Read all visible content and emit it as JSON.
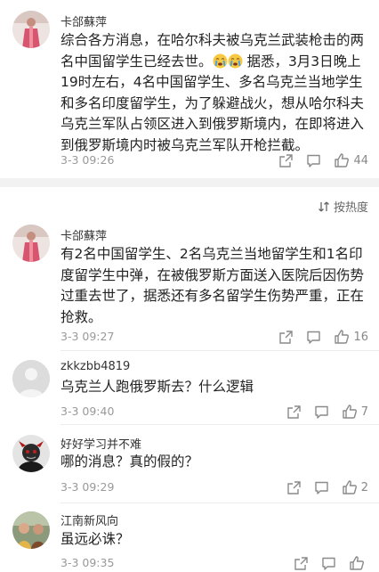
{
  "sort": {
    "label": "按热度"
  },
  "comments": [
    {
      "user": "卡郃蘇萍",
      "text_a": "综合各方消息，在哈尔科夫被乌克兰武装枪击的两名中国留学生已经去世。",
      "text_b": " 据悉，3月3日晚上19时左右，4名中国留学生、多名乌克兰当地学生和多名印度留学生，为了躲避战火，想从哈尔科夫乌克兰军队占领区进入到俄罗斯境内，在即将进入到俄罗斯境内时被乌克兰军队开枪拦截。",
      "emoji_icon": "crying-face-emoji",
      "time": "3-3 09:26",
      "likes": "44"
    },
    {
      "user": "卡郃蘇萍",
      "text": "有2名中国留学生、2名乌克兰当地留学生和1名印度留学生中弹，在被俄罗斯方面送入医院后因伤势过重去世了，据悉还有多名留学生伤势严重，正在抢救。",
      "time": "3-3 09:27",
      "likes": "16"
    },
    {
      "user": "zkkzbb4819",
      "text": "乌克兰人跑俄罗斯去？什么逻辑",
      "time": "3-3 09:40",
      "likes": "7"
    },
    {
      "user": "好好学习并不难",
      "text": "哪的消息？真的假的？",
      "time": "3-3 09:29",
      "likes": "2"
    },
    {
      "user": "江南新风向",
      "text": "虽远必诛？",
      "time": "3-3 09:35",
      "likes": ""
    }
  ],
  "colors": {
    "icon": "#8a8a8a",
    "time": "#999999",
    "separator": "#f2f2f2"
  }
}
